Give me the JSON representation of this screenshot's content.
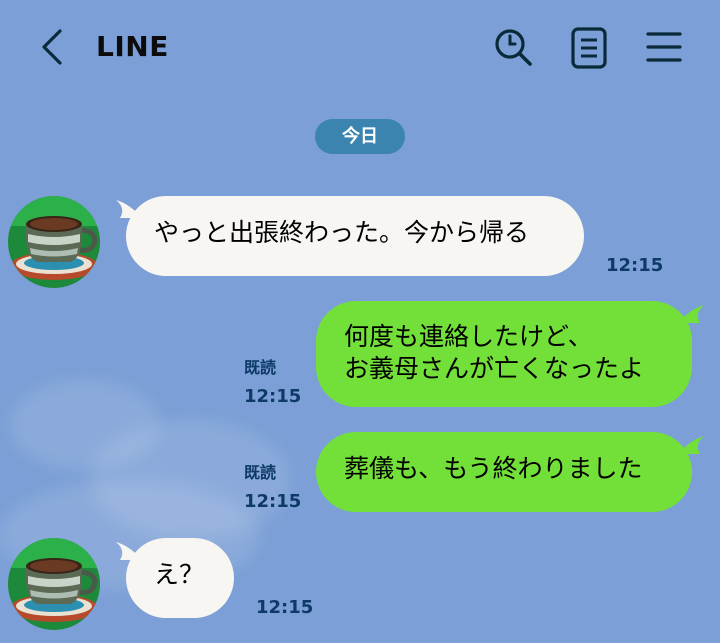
{
  "header": {
    "title": "LINE"
  },
  "date_separator": "今日",
  "messages": [
    {
      "side": "left",
      "lines": [
        "やっと出張終わった。今から帰る"
      ],
      "time": "12:15"
    },
    {
      "side": "right",
      "lines": [
        "何度も連絡したけど、",
        "お義母さんが亡くなったよ"
      ],
      "read": "既読",
      "time": "12:15"
    },
    {
      "side": "right",
      "lines": [
        "葬儀も、もう終わりました"
      ],
      "read": "既読",
      "time": "12:15"
    },
    {
      "side": "left",
      "lines": [
        "え？"
      ],
      "time": "12:15"
    }
  ],
  "icons": {
    "back": "chevron-left-icon",
    "search": "search-icon",
    "notes": "note-icon",
    "menu": "menu-icon"
  },
  "colors": {
    "background": "#7b9fd6",
    "sent_bubble": "#72e038",
    "received_bubble": "#f7f6f3",
    "date_badge": "#3b84b0",
    "meta_text": "#0d3a66"
  }
}
